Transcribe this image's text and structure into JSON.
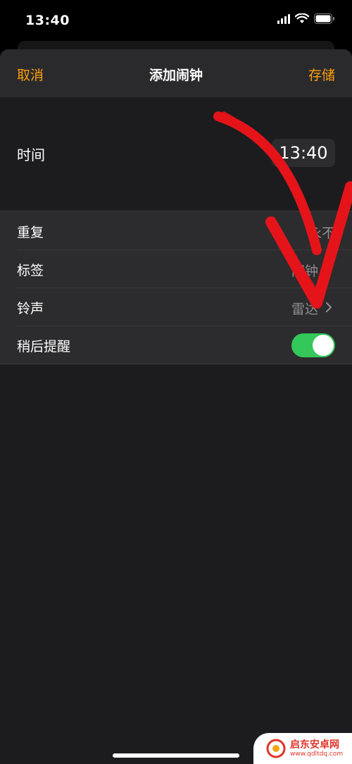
{
  "status_bar": {
    "time": "13:40",
    "icons": [
      "signal-icon",
      "wifi-icon",
      "battery-icon"
    ]
  },
  "nav": {
    "cancel": "取消",
    "title": "添加闹钟",
    "save": "存储"
  },
  "time_row": {
    "label": "时间",
    "value": "13:40"
  },
  "settings": [
    {
      "label": "重复",
      "value": "永不",
      "chevron": false
    },
    {
      "label": "标签",
      "value": "闹钟",
      "chevron": true
    },
    {
      "label": "铃声",
      "value": "雷达",
      "chevron": true
    },
    {
      "label": "稍后提醒",
      "toggle_on": true
    }
  ],
  "watermark": {
    "title": "启东安卓网",
    "url": "www.qdltdq.com"
  },
  "colors": {
    "accent": "#ff9f0a",
    "toggle_on": "#34c759",
    "sheet_bg": "#1c1c1e",
    "annotation_arrow": "#e4141a"
  }
}
